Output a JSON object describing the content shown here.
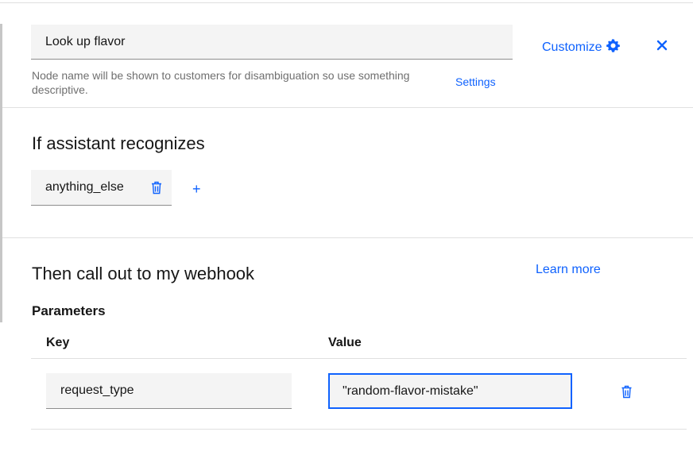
{
  "header": {
    "node_name": "Look up flavor",
    "helper_text": "Node name will be shown to customers for disambiguation so use something descriptive.",
    "settings_label": "Settings",
    "customize_label": "Customize",
    "customize_icon": "gear-icon",
    "close_icon": "close-icon"
  },
  "condition": {
    "title": "If assistant recognizes",
    "chip_label": "anything_else",
    "add_icon": "plus-icon",
    "add_symbol": "+"
  },
  "webhook": {
    "title": "Then call out to my webhook",
    "learn_more_label": "Learn more",
    "parameters_label": "Parameters",
    "columns": {
      "key": "Key",
      "value": "Value"
    },
    "rows": [
      {
        "key": "request_type",
        "value": "\"random-flavor-mistake\""
      }
    ]
  },
  "colors": {
    "accent": "#0f62fe",
    "field_bg": "#f4f4f4",
    "text": "#161616",
    "helper": "#6f6f6f"
  }
}
